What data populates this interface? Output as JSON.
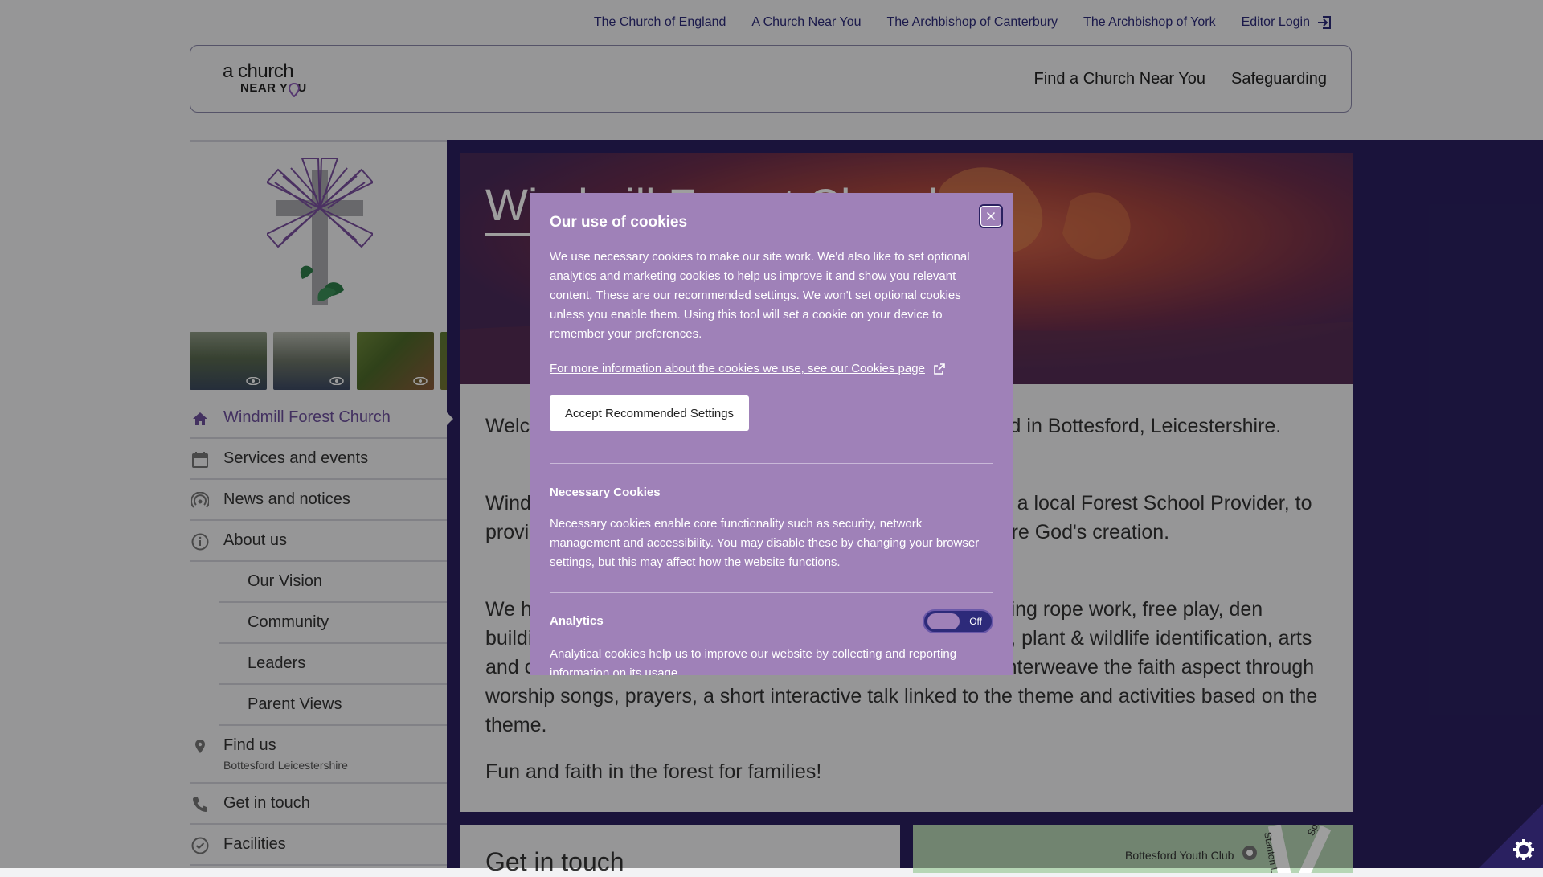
{
  "utility_nav": {
    "items": [
      "The Church of England",
      "A Church Near You",
      "The Archbishop of Canterbury",
      "The Archbishop of York"
    ],
    "login": "Editor Login"
  },
  "logo": {
    "line1": "a church",
    "line2_a": "NEAR Y",
    "line2_b": "U"
  },
  "main_nav": {
    "find": "Find a Church Near You",
    "safeguarding": "Safeguarding"
  },
  "sidebar": {
    "items": [
      {
        "label": "Windmill Forest Church",
        "icon": "home-icon",
        "active": true
      },
      {
        "label": "Services and events",
        "icon": "calendar-icon"
      },
      {
        "label": "News and notices",
        "icon": "broadcast-icon"
      },
      {
        "label": "About us",
        "icon": "info-icon"
      }
    ],
    "subitems": [
      "Our Vision",
      "Community",
      "Leaders",
      "Parent Views"
    ],
    "find_us": {
      "label": "Find us",
      "sub": "Bottesford Leicestershire"
    },
    "more": [
      {
        "label": "Get in touch",
        "icon": "phone-icon"
      },
      {
        "label": "Facilities",
        "icon": "check-circle-icon"
      }
    ]
  },
  "hero": {
    "title": "Windmill Forest Church"
  },
  "body": {
    "p1": "Welcome to Windmill Forest Church, a Forest Church based in Bottesford, Leicestershire.",
    "p2": "Windmill Forest Church works with 'Woodland Wonder Ltd', a local Forest School Provider, to provide a space where children and their parents can explore God's creation.",
    "p3": "We have lots of different activities for everyone there including rope work, free play, den building, fire lighting, cooking, safe use of tools and carving, plant & wildlife identification, arts and crafts. Each session has a faith-based theme and we interweave the faith aspect through worship songs, prayers, a short interactive talk linked to the theme and activities based on the theme.",
    "p4": "Fun and faith in the forest for families!"
  },
  "bottom": {
    "get_in_touch": "Get in touch"
  },
  "map": {
    "label": "Bottesford Youth Club",
    "road1": "Stanton Ln",
    "road2": "Spire View"
  },
  "cookie_modal": {
    "title": "Our use of cookies",
    "intro": "We use necessary cookies to make our site work. We'd also like to set optional analytics and marketing cookies to help us improve it and show you relevant content. These are our recommended settings. We won't set optional cookies unless you enable them. Using this tool will set a cookie on your device to remember your preferences.",
    "more_link": "For more information about the cookies we use, see our Cookies page",
    "accept": "Accept Recommended Settings",
    "necessary_title": "Necessary Cookies",
    "necessary_text": "Necessary cookies enable core functionality such as security, network management and accessibility. You may disable these by changing your browser settings, but this may affect how the website functions.",
    "analytics_title": "Analytics",
    "analytics_toggle": "Off",
    "analytics_text": "Analytical cookies help us to improve our website by collecting and reporting information on its usage."
  },
  "colors": {
    "brand": "#2d2a7a",
    "accent": "#6d4f9c",
    "modal": "#9f81b8"
  }
}
